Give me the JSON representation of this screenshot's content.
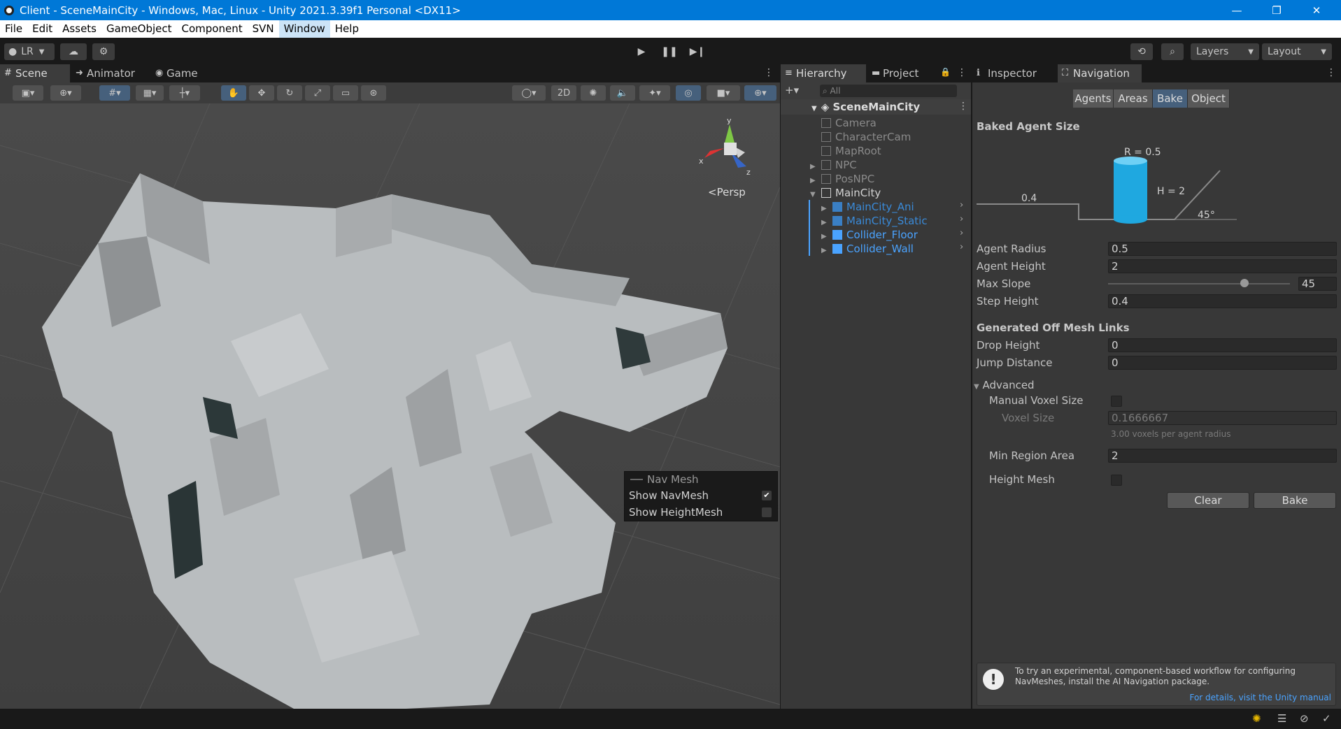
{
  "window": {
    "title": "Client - SceneMainCity - Windows, Mac, Linux - Unity 2021.3.39f1 Personal <DX11>",
    "minimize": "—",
    "maximize": "❐",
    "close": "✕"
  },
  "menu": [
    "File",
    "Edit",
    "Assets",
    "GameObject",
    "Component",
    "SVN",
    "Window",
    "Help"
  ],
  "toolbar": {
    "account": "LR",
    "layers": "Layers",
    "layout": "Layout"
  },
  "scene_tabs": [
    {
      "label": "Scene",
      "icon": "grid-icon"
    },
    {
      "label": "Animator",
      "icon": "animator-icon"
    },
    {
      "label": "Game",
      "icon": "gamepad-icon"
    }
  ],
  "scene_toolbar": {
    "mode_2d": "2D"
  },
  "gizmo": {
    "x": "x",
    "y": "y",
    "z": "z",
    "projection": "Persp"
  },
  "navmesh_overlay": {
    "title": "Nav Mesh",
    "items": [
      {
        "label": "Show NavMesh",
        "checked": true
      },
      {
        "label": "Show HeightMesh",
        "checked": false
      }
    ]
  },
  "hierarchy": {
    "tabs": [
      "Hierarchy",
      "Project"
    ],
    "search_placeholder": "All",
    "scene": "SceneMainCity",
    "items": [
      {
        "label": "Camera",
        "depth": 1,
        "style": "dim"
      },
      {
        "label": "CharacterCam",
        "depth": 1,
        "style": "dim"
      },
      {
        "label": "MapRoot",
        "depth": 1,
        "style": "dim"
      },
      {
        "label": "NPC",
        "depth": 1,
        "style": "dim"
      },
      {
        "label": "PosNPC",
        "depth": 1,
        "style": "dim"
      },
      {
        "label": "MainCity",
        "depth": 1,
        "style": "normal"
      },
      {
        "label": "MainCity_Ani",
        "depth": 2,
        "style": "blue-dim"
      },
      {
        "label": "MainCity_Static",
        "depth": 2,
        "style": "blue-dim"
      },
      {
        "label": "Collider_Floor",
        "depth": 2,
        "style": "blue"
      },
      {
        "label": "Collider_Wall",
        "depth": 2,
        "style": "blue"
      }
    ]
  },
  "inspector": {
    "tabs": [
      "Inspector",
      "Navigation"
    ],
    "nav_tabs": [
      "Agents",
      "Areas",
      "Bake",
      "Object"
    ],
    "selected_nav_tab": "Bake",
    "baked_agent_size": {
      "title": "Baked Agent Size",
      "radius_label": "R = 0.5",
      "height_label": "H = 2",
      "step_label": "0.4",
      "slope_label": "45°"
    },
    "fields": {
      "agent_radius": {
        "label": "Agent Radius",
        "value": "0.5"
      },
      "agent_height": {
        "label": "Agent Height",
        "value": "2"
      },
      "max_slope": {
        "label": "Max Slope",
        "value": "45",
        "slider_fraction": 0.75
      },
      "step_height": {
        "label": "Step Height",
        "value": "0.4"
      }
    },
    "offmesh": {
      "title": "Generated Off Mesh Links",
      "drop_height": {
        "label": "Drop Height",
        "value": "0"
      },
      "jump_distance": {
        "label": "Jump Distance",
        "value": "0"
      }
    },
    "advanced": {
      "title": "Advanced",
      "manual_voxel_size": "Manual Voxel Size",
      "voxel_size": {
        "label": "Voxel Size",
        "value": "0.1666667"
      },
      "voxel_hint": "3.00 voxels per agent radius",
      "min_region_area": {
        "label": "Min Region Area",
        "value": "2"
      },
      "height_mesh": "Height Mesh"
    },
    "buttons": {
      "clear": "Clear",
      "bake": "Bake"
    },
    "help": {
      "text": "To try an experimental, component-based workflow for configuring NavMeshes, install the AI Navigation package.",
      "link": "For details, visit the Unity manual"
    }
  },
  "colors": {
    "title_bar": "#0078d7",
    "accent": "#46607c",
    "agent_cylinder": "#1fa8e0",
    "prefab_blue": "#4aa3ff"
  }
}
